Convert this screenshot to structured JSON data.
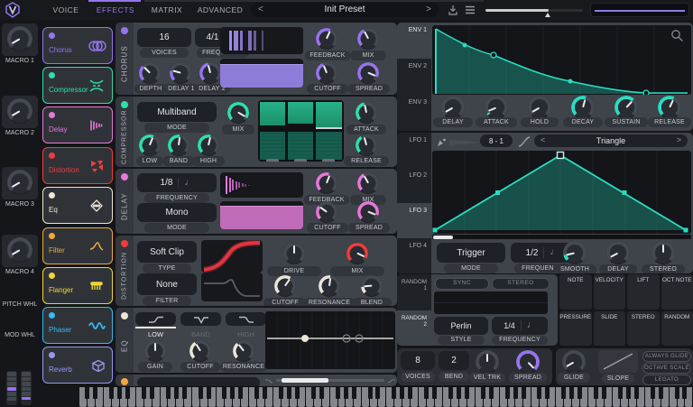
{
  "icons": {
    "note": "♩",
    "prev": "<",
    "next": ">"
  },
  "colors": {
    "accent_purple": "#9674ee",
    "accent_green": "#2ee0a8",
    "accent_pink": "#e678dc",
    "accent_red": "#f23b3b",
    "accent_cream": "#ece6d4",
    "accent_orange": "#f2a83a",
    "accent_yellow": "#f2d635",
    "accent_cyan": "#35baf2",
    "accent_lavender": "#9a96f0",
    "accent_teal": "#2adcc2",
    "display_bg": "#131519",
    "section_bg": "#3f434a"
  },
  "header": {
    "nav": [
      "VOICE",
      "EFFECTS",
      "MATRIX",
      "ADVANCED"
    ],
    "active": "EFFECTS",
    "preset": "Init Preset"
  },
  "left": {
    "macros": [
      "MACRO 1",
      "MACRO 2",
      "MACRO 3",
      "MACRO 4"
    ],
    "pitch": "PITCH WHL",
    "mod": "MOD WHL"
  },
  "fx_list": [
    "Chorus",
    "Compressor",
    "Delay",
    "Distortion",
    "Eq",
    "Filter",
    "Flanger",
    "Phaser",
    "Reverb"
  ],
  "chorus": {
    "title": "CHORUS",
    "voices": "16",
    "voices_l": "VOICES",
    "freq": "4/1",
    "freq_l": "FREQUENCY",
    "feedback": "FEEDBACK",
    "mix": "MIX",
    "depth": "DEPTH",
    "delay1": "DELAY 1",
    "delay2": "DELAY 2",
    "cutoff": "CUTOFF",
    "spread": "SPREAD"
  },
  "comp": {
    "title": "COMPRESSOR",
    "mode": "Multiband",
    "mode_l": "MODE",
    "mix": "MIX",
    "attack": "ATTACK",
    "low": "LOW",
    "band": "BAND",
    "high": "HIGH",
    "release": "RELEASE"
  },
  "delay": {
    "title": "DELAY",
    "freq": "1/8",
    "freq_l": "FREQUENCY",
    "mode": "Mono",
    "mode_l": "MODE",
    "feedback": "FEEDBACK",
    "mix": "MIX",
    "cutoff": "CUTOFF",
    "spread": "SPREAD"
  },
  "dist": {
    "title": "DISTORTION",
    "type": "Soft Clip",
    "type_l": "TYPE",
    "filter": "None",
    "filter_l": "FILTER",
    "drive": "DRIVE",
    "mix": "MIX",
    "cutoff": "CUTOFF",
    "resonance": "RESONANCE",
    "blend": "BLEND"
  },
  "eq": {
    "title": "EQ",
    "low": "LOW",
    "band": "BAND",
    "high": "HIGH",
    "active_band": "LOW",
    "gain": "GAIN",
    "cutoff": "CUTOFF",
    "resonance": "RESONANCE"
  },
  "env": {
    "tabs": [
      "ENV 1",
      "ENV 2",
      "ENV 3"
    ],
    "active": "ENV 1",
    "knobs": [
      "DELAY",
      "ATTACK",
      "HOLD",
      "DECAY",
      "SUSTAIN",
      "RELEASE"
    ]
  },
  "lfo": {
    "tabs": [
      "LFO 1",
      "LFO 2",
      "LFO 3",
      "LFO 4"
    ],
    "active": "LFO 3",
    "grid": "8 - 1",
    "shape": "Triangle",
    "mode": "Trigger",
    "mode_l": "MODE",
    "freq": "1/2",
    "freq_l": "FREQUENCY",
    "smooth": "SMOOTH",
    "delay": "DELAY",
    "stereo": "STEREO"
  },
  "random": {
    "tabs": [
      "RANDOM 1",
      "RANDOM 2"
    ],
    "active": "RANDOM 2",
    "sync": "SYNC",
    "stereo": "STEREO",
    "style": "Perlin",
    "style_l": "STYLE",
    "freq": "1/4",
    "freq_l": "FREQUENCY"
  },
  "mods": [
    "NOTE",
    "VELOCITY",
    "LIFT",
    "OCT NOTE",
    "PRESSURE",
    "SLIDE",
    "STEREO",
    "RANDOM"
  ],
  "voice": {
    "voices": "8",
    "voices_l": "VOICES",
    "bend": "2",
    "bend_l": "BEND",
    "veltrk": "VEL TRK",
    "spread": "SPREAD",
    "glide": "GLIDE",
    "slope": "SLOPE",
    "buttons": [
      "ALWAYS GLIDE",
      "OCTAVE SCALE",
      "LEGATO"
    ]
  }
}
